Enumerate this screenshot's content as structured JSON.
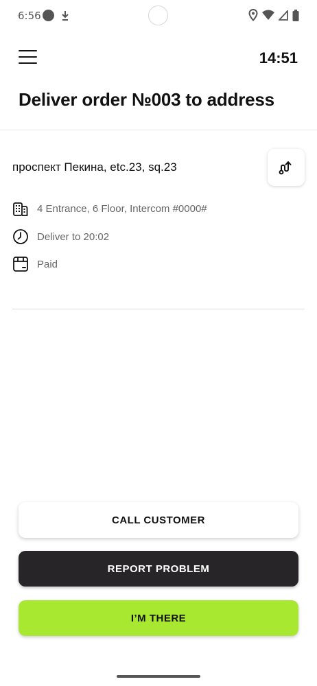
{
  "status_bar": {
    "time": "6:56"
  },
  "header": {
    "clock": "14:51",
    "menu_icon": "hamburger-menu-icon"
  },
  "page": {
    "title": "Deliver order №003 to address"
  },
  "order": {
    "address": "проспект Пекина, etc.23, sq.23",
    "route_icon": "route-icon",
    "details": [
      {
        "icon": "building-icon",
        "text": "4 Entrance, 6 Floor, Intercom #0000#"
      },
      {
        "icon": "clock-icon",
        "text": "Deliver to 20:02"
      },
      {
        "icon": "wallet-icon",
        "text": "Paid"
      }
    ]
  },
  "actions": {
    "call_customer": "CALL CUSTOMER",
    "report_problem": "REPORT PROBLEM",
    "im_there": "I’M THERE"
  },
  "colors": {
    "accent": "#a8e831",
    "dark_button": "#272527",
    "secondary_text": "#666666"
  }
}
